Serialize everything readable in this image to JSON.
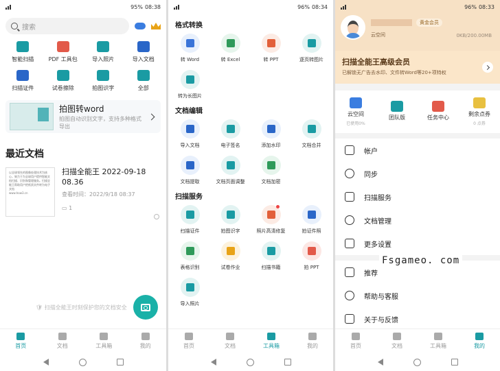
{
  "panel1": {
    "status": {
      "battery": "95%",
      "time": "08:38"
    },
    "search_placeholder": "搜索",
    "tools": [
      {
        "label": "智能扫描",
        "icon": "scan-icon",
        "color": "#1a9ba3"
      },
      {
        "label": "PDF 工具包",
        "icon": "pdf-icon",
        "color": "#e25a4a"
      },
      {
        "label": "导入照片",
        "icon": "image-icon",
        "color": "#1a9ba3"
      },
      {
        "label": "导入文档",
        "icon": "import-doc-icon",
        "color": "#2a66c8"
      },
      {
        "label": "扫描证件",
        "icon": "id-card-icon",
        "color": "#2a66c8"
      },
      {
        "label": "试卷擦除",
        "icon": "erase-icon",
        "color": "#1a9ba3"
      },
      {
        "label": "拍图识字",
        "icon": "ocr-icon",
        "color": "#1a9ba3"
      },
      {
        "label": "全部",
        "icon": "all-apps-icon",
        "color": "#1a9ba3"
      }
    ],
    "promo": {
      "title": "拍图转word",
      "subtitle": "拍图自动识别文字，支持多种格式导出"
    },
    "recent_title": "最近文档",
    "doc": {
      "title": "扫描全能王 2022-09-18 08.36",
      "meta": "查看时间：2022/9/18 08:37",
      "pages": "1",
      "thumb_text": "以全球领先的图像处理技术为核心，致力于为全球用户提供智能文档扫描、识别和管理服务。扫描全能王帮助用户把纸质文件转为电子文档",
      "thumb_url": "www.how3.cn"
    },
    "secure_text": "扫描全能王时刻保护您的文档安全",
    "nav": [
      {
        "label": "首页",
        "active": true
      },
      {
        "label": "文档",
        "active": false
      },
      {
        "label": "工具箱",
        "active": false
      },
      {
        "label": "我的",
        "active": false
      }
    ]
  },
  "panel2": {
    "status": {
      "battery": "96%",
      "time": "08:34"
    },
    "sections": [
      {
        "title": "格式转换",
        "items": [
          {
            "label": "转 Word",
            "color": "#3a74d8",
            "bg": "#e8f0fc"
          },
          {
            "label": "转 Excel",
            "color": "#2f9a5a",
            "bg": "#e6f5ec"
          },
          {
            "label": "转 PPT",
            "color": "#e2603a",
            "bg": "#fcebe4"
          },
          {
            "label": "逐页转图片",
            "color": "#1a9ba3",
            "bg": "#e2f3f2"
          },
          {
            "label": "转为长图片",
            "color": "#1a9ba3",
            "bg": "#e2f3f2"
          }
        ]
      },
      {
        "title": "文档编辑",
        "items": [
          {
            "label": "导入文档",
            "color": "#2a66c8",
            "bg": "#e8f0fc"
          },
          {
            "label": "电子签名",
            "color": "#1a9ba3",
            "bg": "#e2f3f2"
          },
          {
            "label": "添加水印",
            "color": "#2a66c8",
            "bg": "#e8f0fc"
          },
          {
            "label": "文档合并",
            "color": "#1a9ba3",
            "bg": "#e2f3f2"
          },
          {
            "label": "文档提取",
            "color": "#2a66c8",
            "bg": "#e8f0fc"
          },
          {
            "label": "文档页面调整",
            "color": "#1a9ba3",
            "bg": "#e2f3f2"
          },
          {
            "label": "文档加密",
            "color": "#2f9a5a",
            "bg": "#e6f5ec"
          }
        ]
      },
      {
        "title": "扫描服务",
        "items": [
          {
            "label": "扫描证件",
            "color": "#1a9ba3",
            "bg": "#e2f3f2"
          },
          {
            "label": "拍图识字",
            "color": "#1a9ba3",
            "bg": "#e2f3f2"
          },
          {
            "label": "照片高清修复",
            "color": "#e2603a",
            "bg": "#fcebe4",
            "dot": true
          },
          {
            "label": "拍证件照",
            "color": "#2a66c8",
            "bg": "#e8f0fc"
          },
          {
            "label": "表格识别",
            "color": "#2f9a5a",
            "bg": "#e6f5ec"
          },
          {
            "label": "试卷作业",
            "color": "#e8a317",
            "bg": "#fdf2dc"
          },
          {
            "label": "扫描书籍",
            "color": "#1a9ba3",
            "bg": "#e2f3f2"
          },
          {
            "label": "拍 PPT",
            "color": "#e25a4a",
            "bg": "#fce7e4"
          },
          {
            "label": "导入照片",
            "color": "#1a9ba3",
            "bg": "#e2f3f2"
          }
        ]
      }
    ],
    "nav": [
      {
        "label": "首页",
        "active": false
      },
      {
        "label": "文档",
        "active": false
      },
      {
        "label": "工具箱",
        "active": true
      },
      {
        "label": "我的",
        "active": false
      }
    ]
  },
  "panel3": {
    "status": {
      "battery": "96%",
      "time": "08:33"
    },
    "badge": "黄金会员",
    "cloud_label": "云空间",
    "storage": "0KB/200.00MB",
    "vip_title": "扫描全能王高级会员",
    "vip_sub": "已解锁无广告去水印、文件转Word等20+项特权",
    "quick": [
      {
        "label": "云空间",
        "small": "已使用0%",
        "color": "#3a7de0"
      },
      {
        "label": "团队版",
        "small": "",
        "color": "#1a9ba3"
      },
      {
        "label": "任务中心",
        "small": "",
        "color": "#e25a4a"
      },
      {
        "label": "剩余点券",
        "small": "0 点券",
        "color": "#e8c040"
      }
    ],
    "menu1": [
      "帐户",
      "同步",
      "扫描服务",
      "文档管理",
      "更多设置"
    ],
    "menu2": [
      "推荐",
      "帮助与客服",
      "关于与反馈"
    ],
    "watermark": "Fsgameo. com",
    "nav": [
      {
        "label": "首页",
        "active": false
      },
      {
        "label": "文档",
        "active": false
      },
      {
        "label": "工具箱",
        "active": false
      },
      {
        "label": "我的",
        "active": true
      }
    ]
  }
}
